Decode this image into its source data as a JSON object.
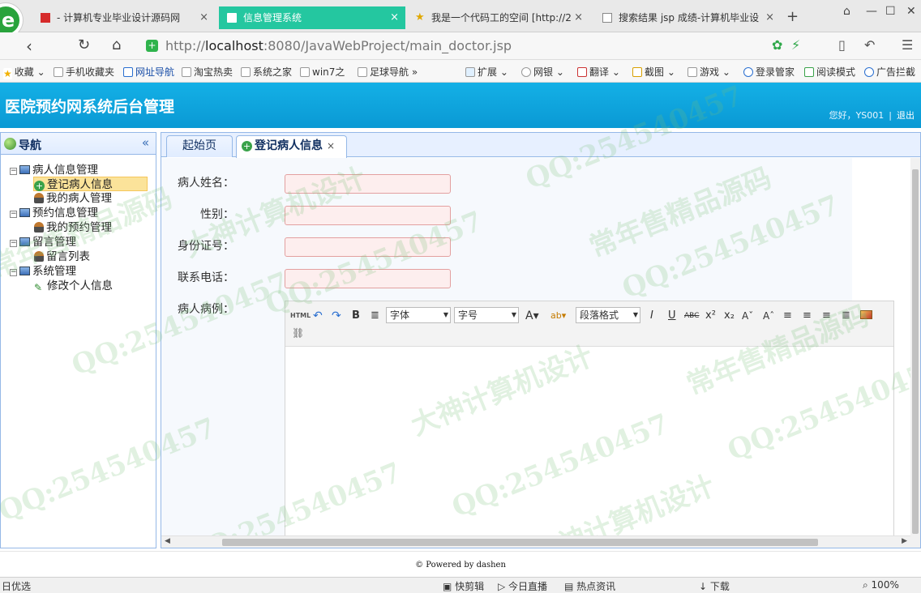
{
  "browser": {
    "tabs": [
      {
        "label": "- 计算机专业毕业设计源码网",
        "active": false
      },
      {
        "label": "信息管理系统",
        "active": true
      },
      {
        "label": "我是一个代码工的空间 [http://2",
        "active": false
      },
      {
        "label": "搜索结果 jsp 成绩-计算机毕业设",
        "active": false
      }
    ],
    "url_host": "localhost",
    "url_prefix": "http://",
    "url_rest": ":8080/JavaWebProject/main_doctor.jsp",
    "bookmarks": [
      "收藏",
      "手机收藏夹",
      "网址导航",
      "淘宝热卖",
      "系统之家",
      "win7之",
      "足球导航"
    ],
    "tools": [
      "扩展",
      "网银",
      "翻译",
      "截图",
      "游戏",
      "登录管家",
      "阅读模式",
      "广告拦截"
    ]
  },
  "header": {
    "title": "医院预约网系统后台管理",
    "greeting": "您好，YS001",
    "logout": "退出"
  },
  "nav": {
    "title": "导航",
    "collapse_icon": "«",
    "groups": [
      {
        "label": "病人信息管理",
        "items": [
          "登记病人信息",
          "我的病人管理"
        ]
      },
      {
        "label": "预约信息管理",
        "items": [
          "我的预约管理"
        ]
      },
      {
        "label": "留言管理",
        "items": [
          "留言列表"
        ]
      },
      {
        "label": "系统管理",
        "items": [
          "修改个人信息"
        ]
      }
    ]
  },
  "content": {
    "tabs": [
      {
        "label": "起始页",
        "active": false
      },
      {
        "label": "登记病人信息",
        "active": true
      }
    ],
    "form": {
      "name_label": "病人姓名：",
      "gender_label": "性别：",
      "id_label": "身份证号：",
      "phone_label": "联系电话：",
      "record_label": "病人病例：",
      "name_value": "",
      "gender_value": "",
      "id_value": "",
      "phone_value": ""
    },
    "editor": {
      "font_select": "字体",
      "size_select": "字号",
      "para_select": "段落格式",
      "html_btn": "HTML"
    }
  },
  "footer": {
    "text": "© Powered by dashen"
  },
  "statusbar": {
    "left": "日优选",
    "items": [
      "快剪辑",
      "今日直播",
      "热点资讯",
      "下载"
    ],
    "zoom": "100%"
  },
  "watermark": {
    "qq": "QQ:254540457",
    "slogan1": "常年售精品源码",
    "slogan2": "大神计算机设计"
  }
}
